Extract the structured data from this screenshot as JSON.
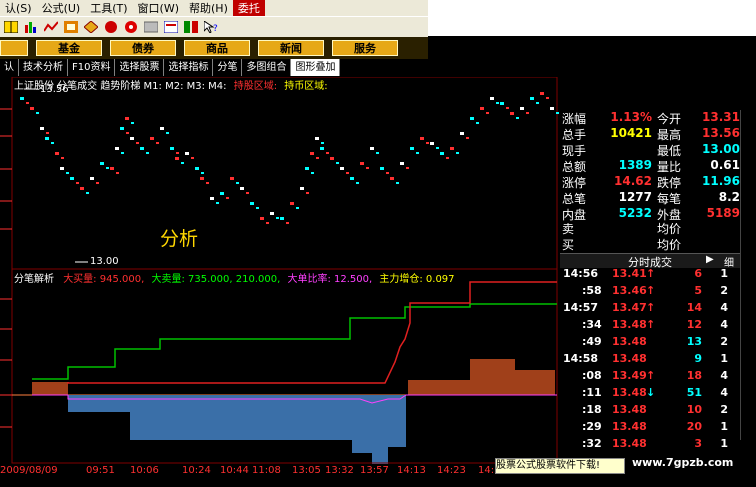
{
  "menu": {
    "items": [
      "认(S)",
      "公式(U)",
      "工具(T)",
      "窗口(W)",
      "帮助(H)",
      "委托"
    ]
  },
  "categories": [
    "基金",
    "债券",
    "商品",
    "新闻",
    "服务"
  ],
  "tabs": [
    "认",
    "技术分析",
    "F10资料",
    "选择股票",
    "选择指标",
    "分笔",
    "多图组合",
    "图形叠加"
  ],
  "chart": {
    "header": "上证股份 分笔成交 趋势阶梯 M1: M2: M3: M4:",
    "header_red": "持股区域:",
    "header_yellow": "持币区域:",
    "high_marker": "13.56",
    "low_marker": "13.00",
    "overlay_text": "分析",
    "sub_title": "分笔解析",
    "sub_items": [
      {
        "label": "大买量: 945.000,",
        "color": "#ff3030"
      },
      {
        "label": "大卖量: 735.000, 210.000,",
        "color": "#00ff00"
      },
      {
        "label": "大单比率: 12.500,",
        "color": "#ff40ff"
      },
      {
        "label": "主力增仓: 0.097",
        "color": "#ffff00"
      }
    ],
    "time_labels": [
      "2009/08/09",
      "09:51",
      "10:06",
      "10:24",
      "10:44",
      "11:08",
      "13:05",
      "13:32",
      "13:57",
      "14:13",
      "14:23",
      "14:3"
    ]
  },
  "quote": {
    "rows": [
      {
        "l1": "涨幅",
        "v1": "1.13%",
        "c1": "#ff3030",
        "l2": "今开",
        "v2": "13.31",
        "c2": "#ff3030"
      },
      {
        "l1": "总手",
        "v1": "10421",
        "c1": "#ffff00",
        "l2": "最高",
        "v2": "13.56",
        "c2": "#ff3030"
      },
      {
        "l1": "现手",
        "v1": "",
        "c1": "#ffff00",
        "l2": "最低",
        "v2": "13.00",
        "c2": "#00ffff"
      },
      {
        "l1": "总额",
        "v1": "1389",
        "c1": "#00ffff",
        "l2": "量比",
        "v2": "0.61",
        "c2": "#ffffff"
      },
      {
        "l1": "涨停",
        "v1": "14.62",
        "c1": "#ff3030",
        "l2": "跌停",
        "v2": "11.96",
        "c2": "#00ffff"
      },
      {
        "l1": "总笔",
        "v1": "1277",
        "c1": "#ffffff",
        "l2": "每笔",
        "v2": "8.2",
        "c2": "#ffffff"
      },
      {
        "l1": "内盘",
        "v1": "5232",
        "c1": "#00ffff",
        "l2": "外盘",
        "v2": "5189",
        "c2": "#ff3030"
      }
    ],
    "buy_sell": [
      {
        "l": "卖",
        "r": "均价"
      },
      {
        "l": "买",
        "r": "均价"
      }
    ]
  },
  "trades_panel": {
    "title": "分时成交",
    "btn_play": "▶",
    "btn_detail": "细",
    "rows": [
      {
        "time": "14:56",
        "price": "13.41",
        "arrow": "↑",
        "vol": "6",
        "n": "1",
        "vcolor": "#ff3030",
        "acolor": "#ff3030"
      },
      {
        "time": ":58",
        "price": "13.46",
        "arrow": "↑",
        "vol": "5",
        "n": "2",
        "vcolor": "#ff3030",
        "acolor": "#ff3030"
      },
      {
        "time": "14:57",
        "price": "13.47",
        "arrow": "↑",
        "vol": "14",
        "n": "4",
        "vcolor": "#ff3030",
        "acolor": "#ff3030"
      },
      {
        "time": ":34",
        "price": "13.48",
        "arrow": "↑",
        "vol": "12",
        "n": "4",
        "vcolor": "#ff3030",
        "acolor": "#ff3030"
      },
      {
        "time": ":49",
        "price": "13.48",
        "arrow": "",
        "vol": "13",
        "n": "2",
        "vcolor": "#00ffff",
        "acolor": "#ff3030"
      },
      {
        "time": "14:58",
        "price": "13.48",
        "arrow": "",
        "vol": "9",
        "n": "1",
        "vcolor": "#00ffff",
        "acolor": "#ff3030"
      },
      {
        "time": ":08",
        "price": "13.49",
        "arrow": "↑",
        "vol": "18",
        "n": "4",
        "vcolor": "#ff3030",
        "acolor": "#ff3030"
      },
      {
        "time": ":11",
        "price": "13.48",
        "arrow": "↓",
        "vol": "51",
        "n": "4",
        "vcolor": "#00ffff",
        "acolor": "#00ffff"
      },
      {
        "time": ":18",
        "price": "13.48",
        "arrow": "",
        "vol": "10",
        "n": "2",
        "vcolor": "#ff3030",
        "acolor": "#ff3030"
      },
      {
        "time": ":29",
        "price": "13.48",
        "arrow": "",
        "vol": "20",
        "n": "1",
        "vcolor": "#ff3030",
        "acolor": "#ff3030"
      },
      {
        "time": ":32",
        "price": "13.48",
        "arrow": "",
        "vol": "3",
        "n": "1",
        "vcolor": "#ff3030",
        "acolor": "#ff3030"
      }
    ]
  },
  "ad_text": "股票公式股票软件下载!",
  "watermark": "www.7gpzb.com"
}
